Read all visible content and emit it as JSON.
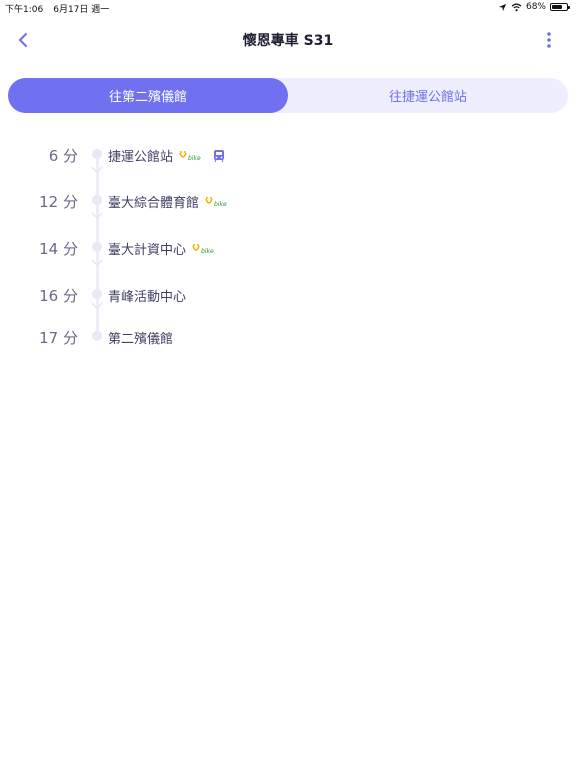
{
  "status_bar": {
    "time": "下午1:06",
    "date": "6月17日 週一",
    "battery": "68%",
    "battery_level": 0.68,
    "icons": [
      "location-arrow-icon",
      "wifi-icon",
      "battery-icon"
    ]
  },
  "nav": {
    "title": "懷恩專車 S31",
    "back_icon": "chevron-left-icon",
    "more_icon": "more-vertical-icon"
  },
  "colors": {
    "accent": "#7071f0",
    "accent_light": "#efeefe",
    "timeline": "#eeeef6"
  },
  "tabs": [
    {
      "label": "往第二殯儀館",
      "active": true
    },
    {
      "label": "往捷運公館站",
      "active": false
    }
  ],
  "stops": [
    {
      "time": "6 分",
      "name": "捷運公館站",
      "ubike": true,
      "metro": true
    },
    {
      "time": "12 分",
      "name": "臺大綜合體育館",
      "ubike": true,
      "metro": false
    },
    {
      "time": "14 分",
      "name": "臺大計資中心",
      "ubike": true,
      "metro": false
    },
    {
      "time": "16 分",
      "name": "青峰活動中心",
      "ubike": false,
      "metro": false
    },
    {
      "time": "17 分",
      "name": "第二殯儀館",
      "ubike": false,
      "metro": false
    }
  ]
}
